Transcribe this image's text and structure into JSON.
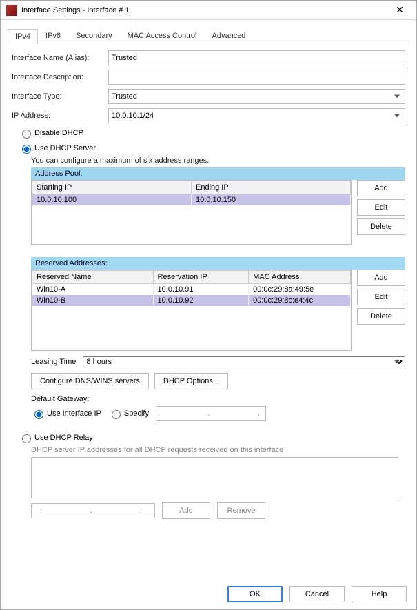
{
  "window": {
    "title": "Interface Settings - Interface # 1"
  },
  "tabs": [
    "IPv4",
    "IPv6",
    "Secondary",
    "MAC Access Control",
    "Advanced"
  ],
  "fields": {
    "name_label": "Interface Name (Alias):",
    "name_value": "Trusted",
    "desc_label": "Interface Description:",
    "desc_value": "",
    "type_label": "Interface Type:",
    "type_value": "Trusted",
    "ip_label": "IP Address:",
    "ip_value": "10.0.10.1/24"
  },
  "dhcp": {
    "disable_label": "Disable DHCP",
    "server_label": "Use DHCP Server",
    "server_hint": "You can configure a maximum of six address ranges.",
    "pool_title": "Address Pool:",
    "pool_headers": [
      "Starting IP",
      "Ending IP"
    ],
    "pool_rows": [
      {
        "start": "10.0.10.100",
        "end": "10.0.10.150"
      }
    ],
    "reserved_title": "Reserved Addresses:",
    "reserved_headers": [
      "Reserved Name",
      "Reservation IP",
      "MAC Address"
    ],
    "reserved_rows": [
      {
        "name": "Win10-A",
        "ip": "10.0.10.91",
        "mac": "00:0c:29:8a:49:5e"
      },
      {
        "name": "Win10-B",
        "ip": "10.0.10.92",
        "mac": "00:0c:29:8c:e4:4c"
      }
    ],
    "btn_add": "Add",
    "btn_edit": "Edit",
    "btn_delete": "Delete",
    "leasing_label": "Leasing Time",
    "leasing_value": "8 hours",
    "dns_btn": "Configure DNS/WINS servers",
    "opts_btn": "DHCP Options...",
    "gw_label": "Default Gateway:",
    "gw_useip": "Use Interface IP",
    "gw_specify": "Specify",
    "gw_ip_placeholder": ".       .       .",
    "relay_label": "Use DHCP Relay",
    "relay_hint": "DHCP server IP addresses for all DHCP requests received on this interface",
    "relay_add": "Add",
    "relay_remove": "Remove"
  },
  "footer": {
    "ok": "OK",
    "cancel": "Cancel",
    "help": "Help"
  }
}
